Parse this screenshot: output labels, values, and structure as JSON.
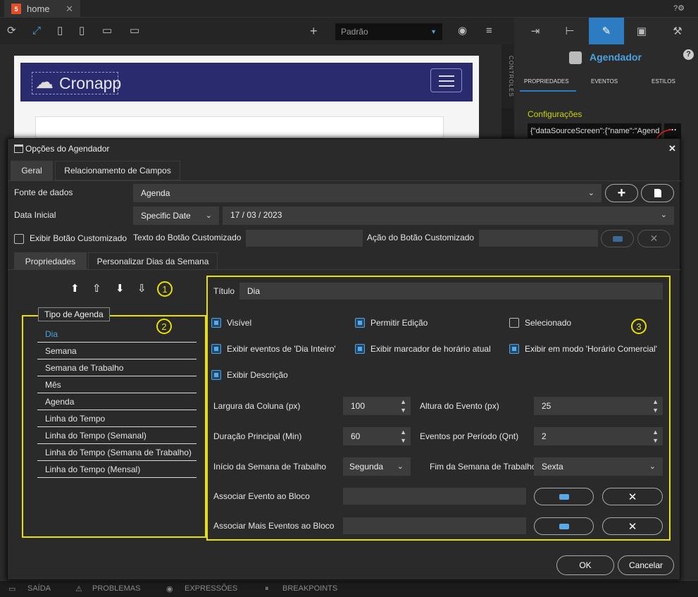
{
  "top_tab": {
    "label": "home"
  },
  "toolbar": {
    "profile": "Padrão"
  },
  "preview": {
    "logo_text": "Cronapp"
  },
  "controls_label": "CONTROLES",
  "right_panel": {
    "title": "Agendador",
    "tabs": [
      "PROPRIEDADES",
      "EVENTOS",
      "ESTILOS"
    ],
    "section": "Configurações",
    "config_value": "{\"dataSourceScreen\":{\"name\":\"Agend"
  },
  "bottom_bar": [
    "SAÍDA",
    "PROBLEMAS",
    "EXPRESSÕES",
    "BREAKPOINTS"
  ],
  "dialog": {
    "title": "Opções do Agendador",
    "tabs": {
      "geral": "Geral",
      "relacionamento": "Relacionamento de Campos"
    },
    "fonte_label": "Fonte de dados",
    "fonte_value": "Agenda",
    "data_inicial_label": "Data Inicial",
    "data_mode": "Specific Date",
    "data_value": "17 / 03 / 2023",
    "exibir_botao_label": "Exibir Botão Customizado",
    "texto_botao_label": "Texto do Botão Customizado",
    "acao_botao_label": "Ação do Botão Customizado",
    "subtabs": {
      "propriedades": "Propriedades",
      "personalizar": "Personalizar Dias da Semana"
    },
    "annotations": [
      "1",
      "2",
      "3"
    ],
    "tipo_agenda_legend": "Tipo de Agenda",
    "tipo_agenda_items": [
      "Dia",
      "Semana",
      "Semana de Trabalho",
      "Mês",
      "Agenda",
      "Linha do Tempo",
      "Linha do Tempo (Semanal)",
      "Linha do Tempo (Semana de Trabalho)",
      "Linha do Tempo (Mensal)"
    ],
    "titulo_label": "Título",
    "titulo_value": "Dia",
    "checks": {
      "visivel": "Visível",
      "permitir_edicao": "Permitir Edição",
      "selecionado": "Selecionado",
      "dia_inteiro": "Exibir eventos de 'Dia Inteiro'",
      "marcador": "Exibir marcador de horário atual",
      "comercial": "Exibir em modo 'Horário Comercial'",
      "descricao": "Exibir Descrição"
    },
    "largura_label": "Largura da Coluna (px)",
    "largura_value": "100",
    "altura_label": "Altura do Evento (px)",
    "altura_value": "25",
    "duracao_label": "Duração Principal (Min)",
    "duracao_value": "60",
    "eventos_label": "Eventos por Período (Qnt)",
    "eventos_value": "2",
    "inicio_label": "Início da Semana de Trabalho",
    "inicio_value": "Segunda",
    "fim_label": "Fim da Semana de Trabalho",
    "fim_value": "Sexta",
    "assoc_label": "Associar Evento ao Bloco",
    "assoc_mais_label": "Associar Mais Eventos ao Bloco",
    "ok": "OK",
    "cancel": "Cancelar"
  }
}
